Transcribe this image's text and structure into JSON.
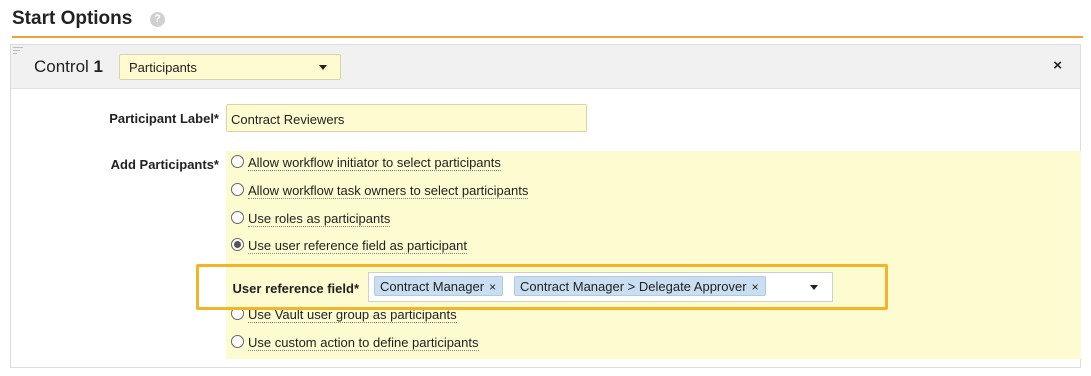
{
  "section": {
    "title": "Start Options",
    "help_icon": "?"
  },
  "control": {
    "label_prefix": "Control",
    "number": "1",
    "type_value": "Participants",
    "close_glyph": "×"
  },
  "fields": {
    "participant_label": {
      "label": "Participant Label*",
      "value": "Contract Reviewers"
    },
    "add_participants": {
      "label": "Add Participants*",
      "options": [
        {
          "label": "Allow workflow initiator to select participants",
          "checked": false
        },
        {
          "label": "Allow workflow task owners to select participants",
          "checked": false
        },
        {
          "label": "Use roles as participants",
          "checked": false
        },
        {
          "label": "Use user reference field as participant",
          "checked": true
        },
        {
          "label": "Use Vault user group as participants",
          "checked": false
        },
        {
          "label": "Use custom action to define participants",
          "checked": false
        }
      ]
    },
    "user_reference_field": {
      "label": "User reference field*",
      "tokens": [
        {
          "label": "Contract Manager",
          "remove": "×"
        },
        {
          "label": "Contract Manager > Delegate Approver",
          "remove": "×"
        }
      ]
    }
  },
  "colors": {
    "accent": "#f0a23a",
    "highlight": "#f5b428",
    "field_background": "#fffbd0",
    "token_background": "#c9def1"
  },
  "icons": {
    "help": "question-circle-icon",
    "close": "close-icon",
    "dropdown": "caret-down-icon",
    "drag": "drag-handle-icon"
  }
}
